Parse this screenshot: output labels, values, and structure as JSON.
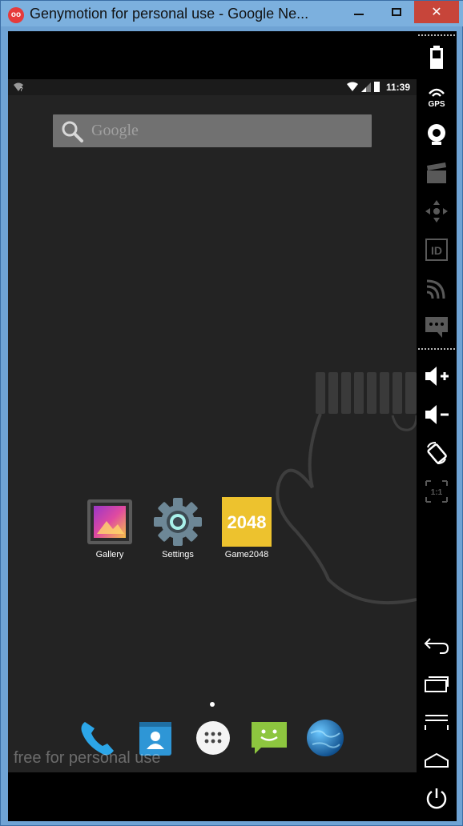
{
  "window": {
    "title": "Genymotion for personal use - Google Ne...",
    "logo_text": "oo",
    "min_label": "",
    "max_label": "",
    "close_label": "✕"
  },
  "status_bar": {
    "time": "11:39"
  },
  "search": {
    "placeholder": "Google"
  },
  "apps": [
    {
      "label": "Gallery"
    },
    {
      "label": "Settings"
    },
    {
      "label": "Game2048",
      "tile_text": "2048"
    }
  ],
  "dock": [
    "phone",
    "contacts",
    "app-drawer",
    "messaging",
    "browser"
  ],
  "watermark": "free for personal use",
  "sidebar_tools": [
    {
      "name": "battery-icon",
      "enabled": true
    },
    {
      "name": "gps-icon",
      "label": "GPS",
      "enabled": true
    },
    {
      "name": "webcam-icon",
      "enabled": true
    },
    {
      "name": "screencast-icon",
      "enabled": false
    },
    {
      "name": "dpad-icon",
      "enabled": false
    },
    {
      "name": "device-id-icon",
      "label": "ID",
      "enabled": false
    },
    {
      "name": "network-icon",
      "enabled": false
    },
    {
      "name": "sms-icon",
      "enabled": false
    },
    {
      "name": "volume-up-icon",
      "enabled": true
    },
    {
      "name": "volume-down-icon",
      "enabled": true
    },
    {
      "name": "rotate-icon",
      "enabled": true
    },
    {
      "name": "pixel-perfect-icon",
      "label": "1:1",
      "enabled": false
    },
    {
      "name": "back-icon",
      "enabled": true
    },
    {
      "name": "recent-apps-icon",
      "enabled": true
    },
    {
      "name": "menu-icon",
      "enabled": true
    },
    {
      "name": "home-icon",
      "enabled": true
    },
    {
      "name": "power-icon",
      "enabled": true
    }
  ],
  "colors": {
    "titlebar": "#7cb0de",
    "close_button": "#c7453a",
    "screen_bg": "#232323",
    "search_bg": "#717171",
    "game2048_tile": "#edc22e"
  }
}
